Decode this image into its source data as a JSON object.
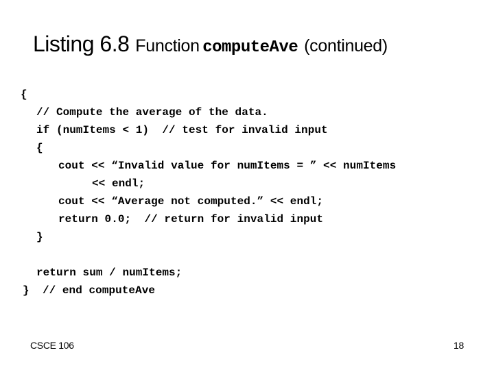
{
  "slide": {
    "title": {
      "listing": "Listing 6.8",
      "prefix": "Function",
      "function_name": "computeAve",
      "suffix": "(continued)"
    },
    "code_lines": [
      "{",
      "// Compute the average of the data.",
      "if (numItems < 1)  // test for invalid input",
      "{",
      "cout << “Invalid value for numItems = ” << numItems",
      "<< endl;",
      "cout << “Average not computed.” << endl;",
      "return 0.0;  // return for invalid input",
      "}",
      "return sum / numItems;",
      "}  // end computeAve"
    ],
    "footer": {
      "course": "CSCE 106",
      "page_number": "18"
    }
  }
}
